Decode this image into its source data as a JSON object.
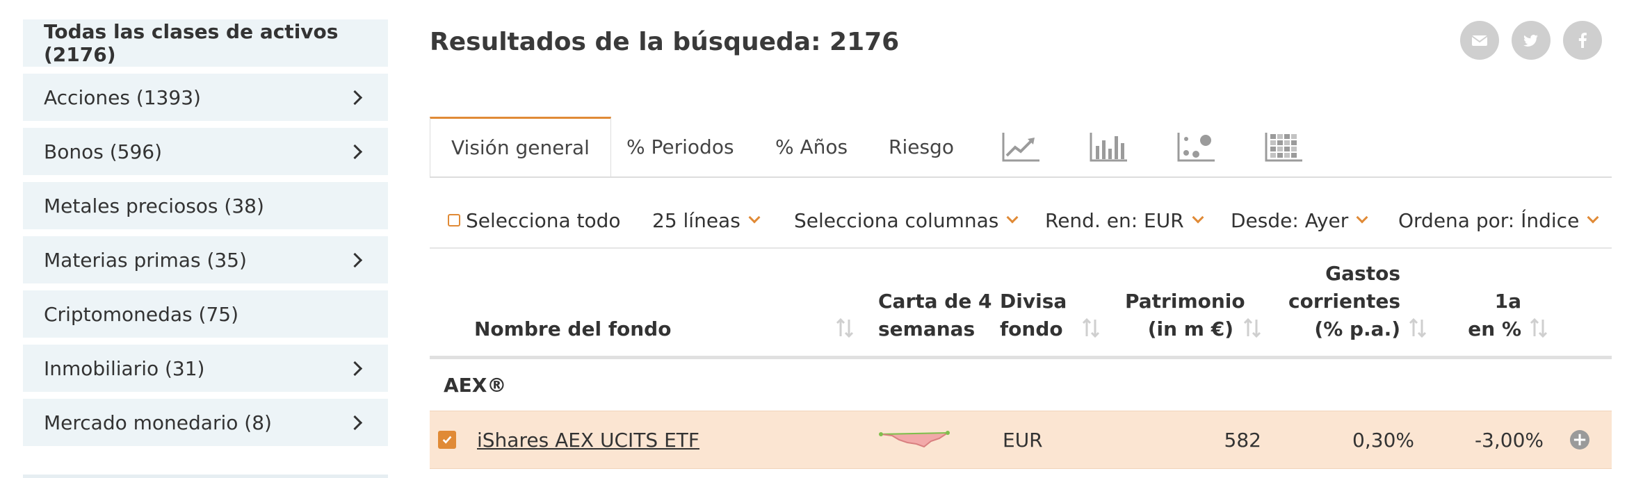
{
  "sidebar": {
    "items": [
      {
        "label": "Todas las clases de activos (2176)"
      },
      {
        "label": "Acciones (1393)"
      },
      {
        "label": "Bonos (596)"
      },
      {
        "label": "Metales preciosos (38)"
      },
      {
        "label": "Materias primas (35)"
      },
      {
        "label": "Criptomonedas (75)"
      },
      {
        "label": "Inmobiliario (31)"
      },
      {
        "label": "Mercado monedario (8)"
      }
    ]
  },
  "header": {
    "title": "Resultados de la búsqueda: 2176",
    "share_icons": [
      "email-icon",
      "twitter-icon",
      "facebook-icon"
    ]
  },
  "tabs": [
    {
      "label": "Visión general"
    },
    {
      "label": "% Periodos"
    },
    {
      "label": "% Años"
    },
    {
      "label": "Riesgo"
    }
  ],
  "tab_icons": [
    "line-chart-icon",
    "bar-chart-icon",
    "scatter-chart-icon",
    "heatmap-grid-icon"
  ],
  "toolbar": {
    "select_all": "Selecciona todo",
    "lines": "25 líneas",
    "columns": "Selecciona columnas",
    "currency": "Rend. en: EUR",
    "since": "Desde: Ayer",
    "sort": "Ordena por: Índice"
  },
  "table": {
    "headers": {
      "name": "Nombre del fondo",
      "chart_l1": "Carta de 4",
      "chart_l2": "semanas",
      "currency_l1": "Divisa",
      "currency_l2": "fondo",
      "assets_l1": "Patrimonio",
      "assets_l2": "(in m €)",
      "costs_l1": "Gastos",
      "costs_l2": "corrientes",
      "costs_l3": "(% p.a.)",
      "return_l1": "1a",
      "return_l2": "en %"
    },
    "group": "AEX®",
    "rows": [
      {
        "name": "iShares AEX UCITS ETF",
        "currency": "EUR",
        "assets": "582",
        "costs": "0,30%",
        "return_1y": "-3,00%",
        "selected": true
      }
    ]
  },
  "colors": {
    "accent": "#e08a36",
    "sidebar_bg": "#edf4f7",
    "selected_row_bg": "#fbe5d2",
    "share_icon_bg": "#cfcfcf"
  }
}
